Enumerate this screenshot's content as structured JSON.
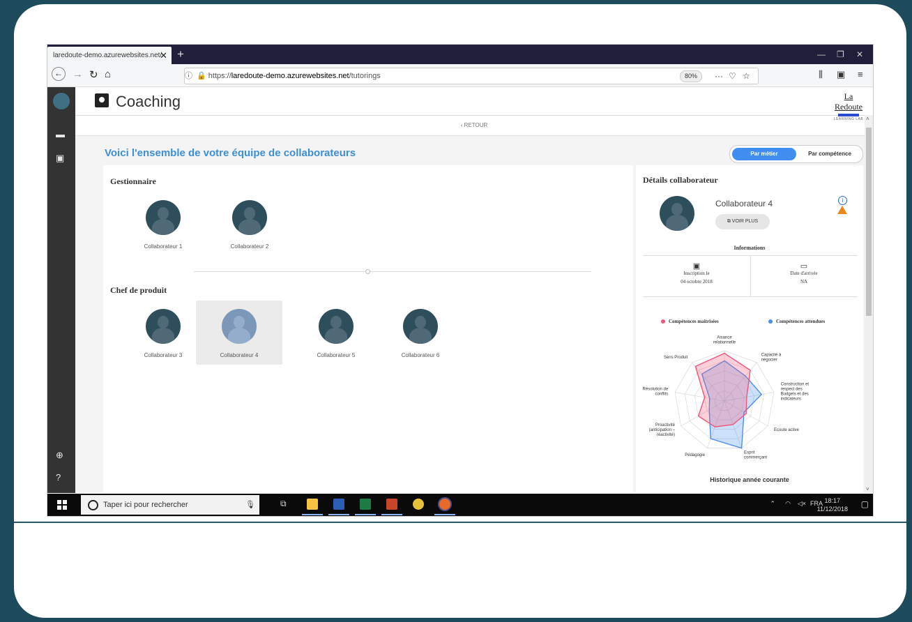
{
  "browser": {
    "tab_title": "laredoute-demo.azurewebsites.net/",
    "tab_close": "✕",
    "new_tab": "+",
    "url_prefix": "https://",
    "url_host": "laredoute-demo.azurewebsites.net",
    "url_path": "/tutorings",
    "zoom": "80%",
    "url_more": "···"
  },
  "app": {
    "title": "Coaching",
    "logo_name": "La Redoute",
    "logo_sub": "LEARNING LAB",
    "back_label": "RETOUR",
    "page_title": "Voici l'ensemble de votre équipe de collaborateurs",
    "toggle": {
      "active": "Par métier",
      "inactive": "Par compétence"
    }
  },
  "sections": [
    {
      "title": "Gestionnaire",
      "members": [
        "Collaborateur 1",
        "Collaborateur 2"
      ]
    },
    {
      "title": "Chef de produit",
      "members": [
        "Collaborateur 3",
        "Collaborateur 4",
        "Collaborateur 5",
        "Collaborateur 6"
      ]
    }
  ],
  "selected_member": "Collaborateur 4",
  "details": {
    "title": "Détails collaborateur",
    "name": "Collaborateur 4",
    "voir_plus": "VOIR PLUS",
    "info_title": "Informations",
    "inscription_label": "Inscription le",
    "inscription_value": "04 octobre 2018",
    "arrivee_label": "Date d'arrivée",
    "arrivee_value": "NA",
    "legend_mastered": "Compétences maitrisées",
    "legend_expected": "Compétences attendues",
    "history_title": "Historique année courante"
  },
  "radar": {
    "axes": [
      "Aisance relationnelle",
      "Capacité à négocier",
      "Construction et respect des Budgets et des indicateurs",
      "Ecoute active",
      "Esprit commerçant",
      "Pédagogie",
      "Proactivité (anticipation – réactivité)",
      "Résolution de conflits",
      "Sens Produit"
    ],
    "series": [
      {
        "name": "Compétences maitrisées",
        "color": "#f0567a",
        "values": [
          0.95,
          0.8,
          0.45,
          0.5,
          0.5,
          0.55,
          0.6,
          0.4,
          0.9
        ]
      },
      {
        "name": "Compétences attendues",
        "color": "#4a8fe8",
        "values": [
          0.8,
          0.65,
          0.75,
          0.45,
          1.0,
          0.8,
          0.35,
          0.3,
          0.7
        ]
      }
    ]
  },
  "taskbar": {
    "search_placeholder": "Taper ici pour rechercher",
    "lang": "FRA",
    "time": "18:17",
    "date": "11/12/2018"
  },
  "colors": {
    "accent": "#3d8fd6",
    "toggle_active": "#3f8ef0",
    "sidebar": "#333333",
    "warning": "#e88a1c"
  }
}
